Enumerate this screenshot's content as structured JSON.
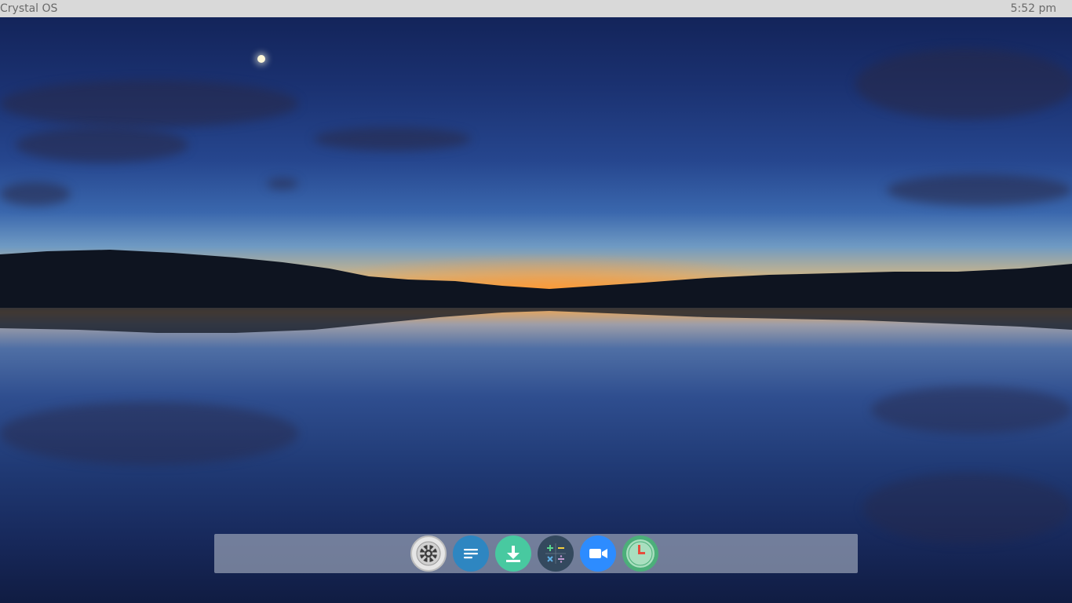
{
  "top_bar": {
    "os_name": "Crystal OS",
    "clock": "5:52 pm"
  },
  "desktop": {
    "wallpaper": "twilight-lake-landscape"
  },
  "dock": {
    "items": [
      {
        "icon": "settings-gear-icon",
        "color": "#e6e6e6"
      },
      {
        "icon": "text-editor-icon",
        "color": "#2e86c1"
      },
      {
        "icon": "download-arrow-icon",
        "color": "#48c9a0"
      },
      {
        "icon": "calculator-icon",
        "color": "#34495e"
      },
      {
        "icon": "video-camera-icon",
        "color": "#2d8cff"
      },
      {
        "icon": "clock-icon",
        "color": "#4caf7a"
      }
    ]
  }
}
